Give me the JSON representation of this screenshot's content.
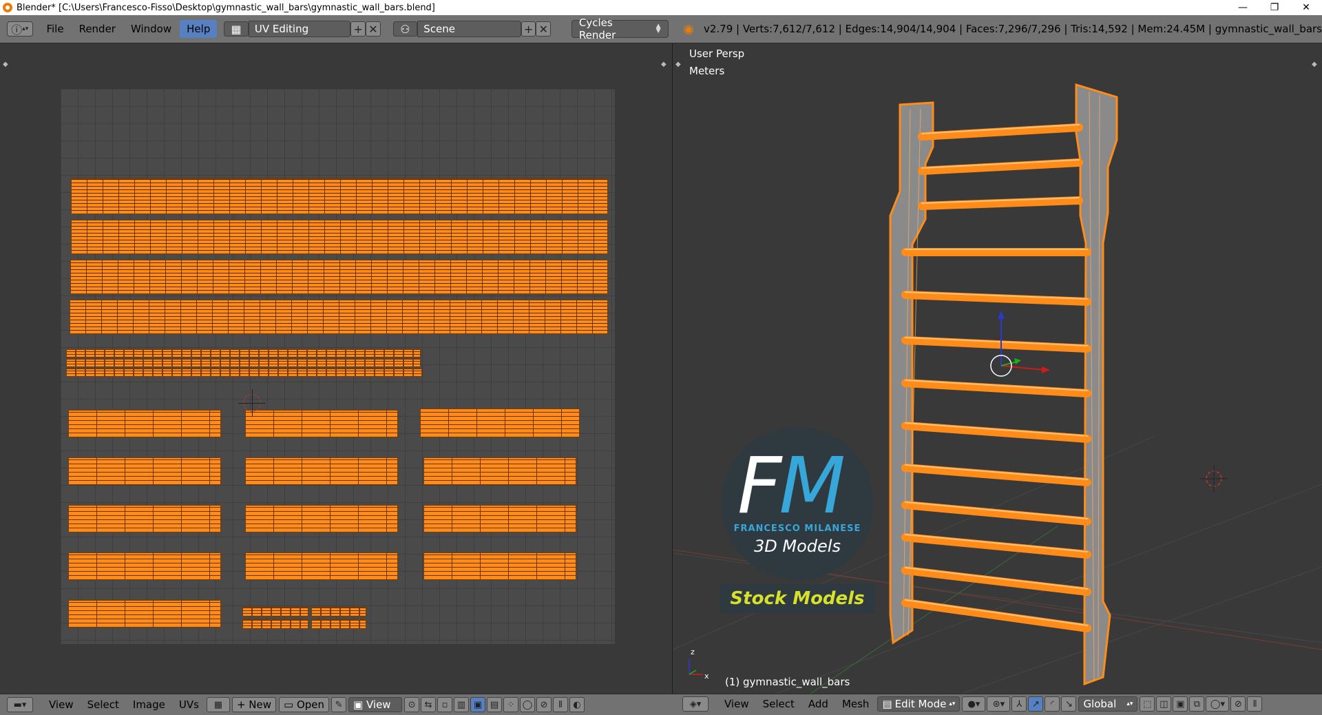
{
  "window": {
    "title": "Blender* [C:\\Users\\Francesco-Fisso\\Desktop\\gymnastic_wall_bars\\gymnastic_wall_bars.blend]",
    "minimize": "—",
    "maximize": "❐",
    "close": "✕"
  },
  "topbar": {
    "menus": [
      "File",
      "Render",
      "Window",
      "Help"
    ],
    "layout_name": "UV Editing",
    "scene_name": "Scene",
    "render_engine": "Cycles Render",
    "stats": "v2.79 | Verts:7,612/7,612 | Edges:14,904/14,904 | Faces:7,296/7,296 | Tris:14,592 | Mem:24.45M | gymnastic_wall_bars"
  },
  "viewport": {
    "view_name": "User Persp",
    "units": "Meters",
    "object_label": "(1) gymnastic_wall_bars",
    "axis_z": "z",
    "axis_x": "x"
  },
  "watermark": {
    "monogram_f": "F",
    "monogram_m": "M",
    "author": "FRANCESCO MILANESE",
    "subtitle": "3D Models",
    "badge": "Stock Models"
  },
  "uv_bottombar": {
    "menus": [
      "View",
      "Select",
      "Image",
      "UVs"
    ],
    "new_label": "New",
    "open_label": "Open",
    "view_label": "View"
  },
  "viewport_bottombar": {
    "menus": [
      "View",
      "Select",
      "Add",
      "Mesh"
    ],
    "mode": "Edit Mode",
    "orientation": "Global"
  },
  "colors": {
    "selection": "#ff8c18",
    "active_menu": "#5680c2",
    "header": "#727272",
    "background": "#393939",
    "logo_accent": "#36a7d8",
    "badge_text": "#d7e02a"
  }
}
